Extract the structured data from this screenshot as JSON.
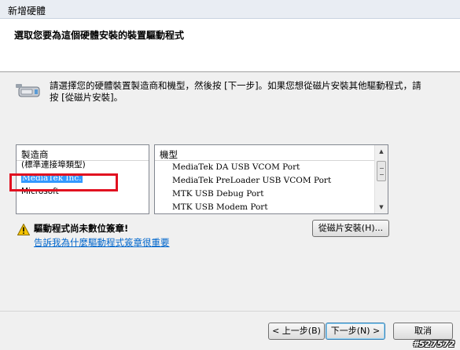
{
  "window": {
    "title": "新增硬體"
  },
  "header": {
    "heading": "選取您要為這個硬體安裝的裝置驅動程式"
  },
  "instruction": "請選擇您的硬體裝置製造商和機型，然後按 [下一步]。如果您想從磁片安裝其他驅動程式，請按 [從磁片安裝]。",
  "manufacturers": {
    "header": "製造商",
    "items": [
      {
        "label": "(標準連接埠類型)"
      },
      {
        "label": "MediaTek Inc.",
        "selected": true
      },
      {
        "label": "Microsoft"
      }
    ]
  },
  "models": {
    "header": "機型",
    "items": [
      {
        "label": "MediaTek DA USB VCOM Port"
      },
      {
        "label": "MediaTek PreLoader USB VCOM Port"
      },
      {
        "label": "MTK USB Debug Port"
      },
      {
        "label": "MTK USB Modem Port"
      }
    ]
  },
  "signature": {
    "warning": "驅動程式尚未數位簽章!",
    "link": "告訴我為什麼驅動程式簽章很重要",
    "icon": "warning-icon"
  },
  "buttons": {
    "have_disk": "從磁片安裝(H)...",
    "back": "< 上一步(B)",
    "next": "下一步(N) >",
    "cancel": "取消"
  },
  "watermark": "#527572",
  "colors": {
    "selection": "#3399ff",
    "annotation": "#e11020",
    "link": "#0066cc"
  }
}
